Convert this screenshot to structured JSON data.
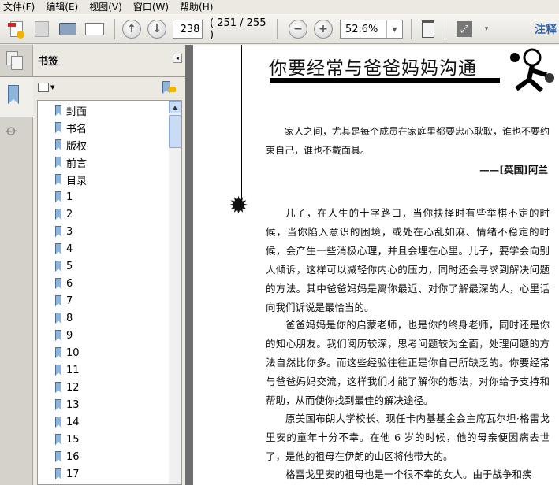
{
  "menu": [
    "文件(F)",
    "编辑(E)",
    "视图(V)",
    "窗口(W)",
    "帮助(H)"
  ],
  "toolbar": {
    "page_number": "238",
    "page_info": "( 251 / 255 )",
    "zoom": "52.6%",
    "comment_label": "注释"
  },
  "panel": {
    "title": "书签",
    "bookmarks": [
      "封面",
      "书名",
      "版权",
      "前言",
      "目录",
      "1",
      "2",
      "3",
      "4",
      "5",
      "6",
      "7",
      "8",
      "9",
      "10",
      "11",
      "12",
      "13",
      "14",
      "15",
      "16",
      "17"
    ]
  },
  "document": {
    "title": "你要经常与爸爸妈妈沟通",
    "quote": "家人之间，尤其是每个成员在家庭里都要忠心耿耿，谁也不要约束自己，谁也不戴面具。",
    "attribution": "——[英国]阿兰",
    "paragraphs": [
      "儿子，在人生的十字路口，当你抉择时有些举棋不定的时候，当你陷入意识的困境，或处在心乱如麻、情绪不稳定的时候，会产生一些消极心理，并且会埋在心里。儿子，要学会向别人倾诉，这样可以减轻你内心的压力，同时还会寻求到解决问题的方法。其中爸爸妈妈是离你最近、对你了解最深的人，心里话向我们诉说是最恰当的。",
      "爸爸妈妈是你的启蒙老师，也是你的终身老师，同时还是你的知心朋友。我们阅历较深，思考问题较为全面，处理问题的方法自然比你多。而这些经验往往正是你自己所缺乏的。你要经常与爸爸妈妈交流，这样我们才能了解你的想法，对你给予支持和帮助，从而使你找到最佳的解决途径。",
      "原美国布朗大学校长、现任卡内基基金会主席瓦尔坦·格雷戈里安的童年十分不幸。在他 6 岁的时候，他的母亲便因病去世了，是他的祖母在伊朗的山区将他带大的。",
      "格雷戈里安的祖母也是一个很不幸的女人。由于战争和疾"
    ]
  }
}
